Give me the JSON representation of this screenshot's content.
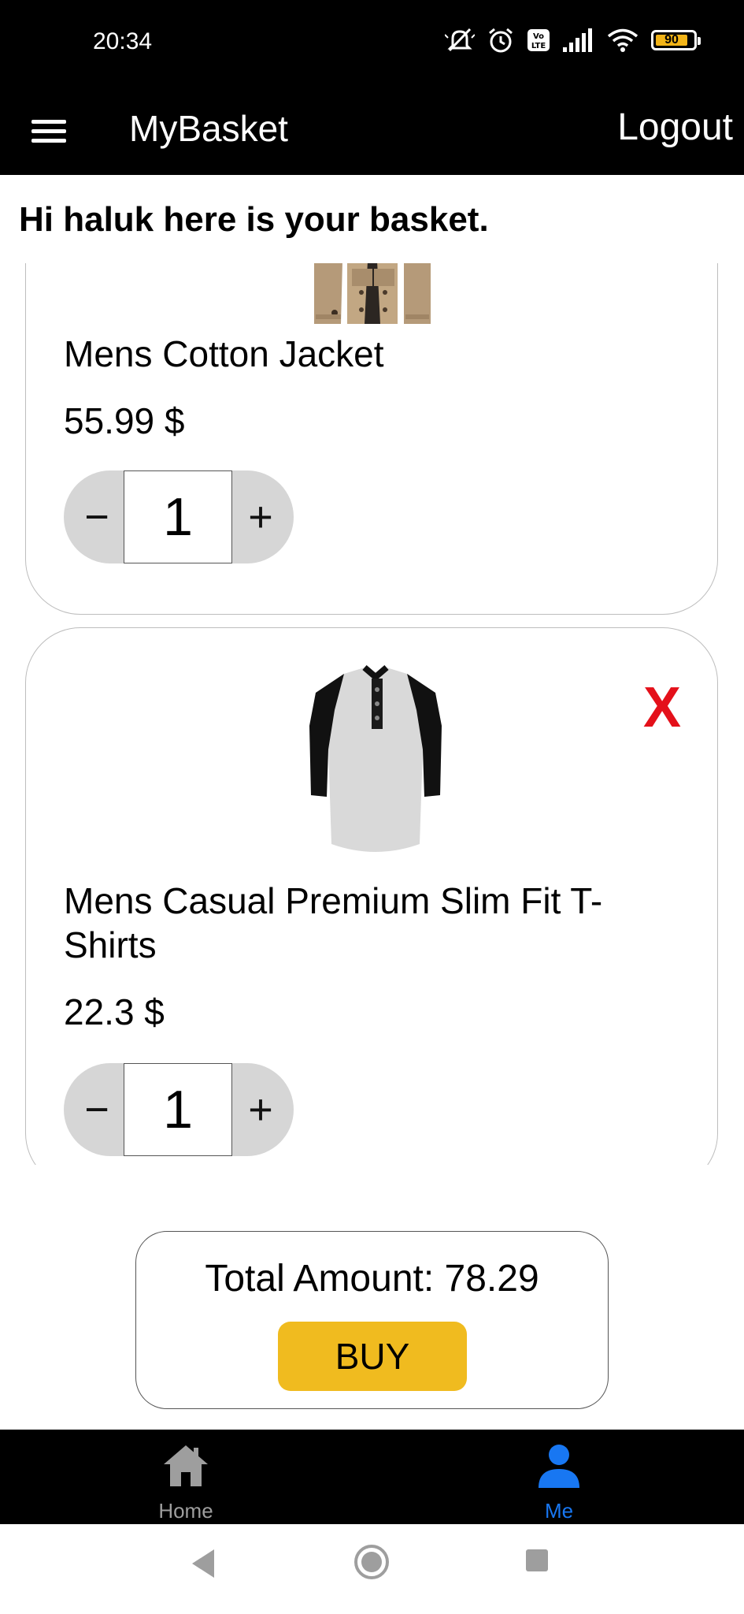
{
  "status_bar": {
    "time": "20:34",
    "battery": "90"
  },
  "app_bar": {
    "title": "MyBasket",
    "logout_label": "Logout"
  },
  "greeting": "Hi haluk here is your basket.",
  "basket": {
    "items": [
      {
        "name": "Mens Cotton Jacket",
        "price": "55.99 $",
        "quantity": "1"
      },
      {
        "name": "Mens Casual Premium Slim Fit T-Shirts",
        "price": "22.3 $",
        "quantity": "1",
        "remove_label": "X"
      }
    ],
    "stepper": {
      "minus": "−",
      "plus": "+"
    }
  },
  "total": {
    "text": "Total Amount: 78.29",
    "buy_label": "BUY"
  },
  "bottom_nav": {
    "items": [
      {
        "label": "Home",
        "icon": "home-icon",
        "active": false
      },
      {
        "label": "Me",
        "icon": "person-icon",
        "active": true
      }
    ]
  },
  "colors": {
    "bar_background": "#000000",
    "buy_button": "#f0bb1f",
    "remove_x": "#e4101a",
    "nav_active": "#1877f2",
    "nav_inactive": "#9e9e9e",
    "stepper_background": "#d6d6d6"
  }
}
